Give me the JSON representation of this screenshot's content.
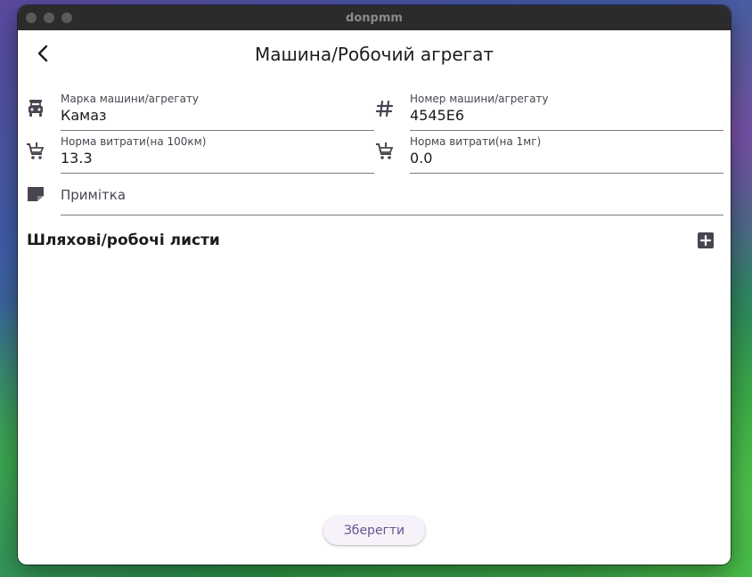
{
  "window": {
    "title": "donpmm"
  },
  "appbar": {
    "title": "Машина/Робочий агрегат",
    "back_icon": "arrow-back-icon"
  },
  "form": {
    "brand": {
      "label": "Марка машини/агрегату",
      "value": "Камаз",
      "icon": "car-icon"
    },
    "number": {
      "label": "Номер машини/агрегату",
      "value": "4545Е6",
      "icon": "hash-icon"
    },
    "norm_100km": {
      "label": "Норма витрати(на 100км)",
      "value": "13.3",
      "icon": "cart-icon"
    },
    "norm_1mh": {
      "label": "Норма витрати(на 1мг)",
      "value": "0.0",
      "icon": "cart-icon"
    },
    "note": {
      "placeholder": "Примітка",
      "value": "",
      "icon": "note-icon"
    }
  },
  "section": {
    "title": "Шляхові/робочі листи",
    "add_icon": "add-box-icon"
  },
  "actions": {
    "save_label": "Зберегти"
  },
  "colors": {
    "accent": "#65558f",
    "text": "#1c1b1f",
    "icon": "#49454f"
  }
}
